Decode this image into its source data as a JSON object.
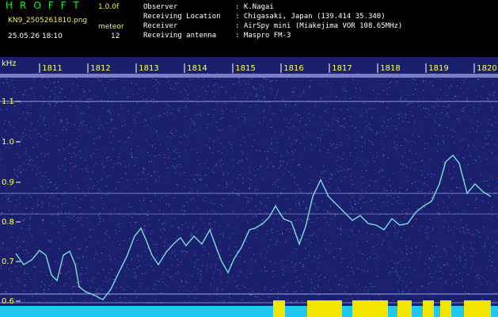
{
  "header": {
    "brand": "HROFFT",
    "version": "1.0.0f",
    "filename": "KN9_2505261810.png",
    "meteor_label": "meteor",
    "timestamp": "25.05.26 18:10",
    "meteor_count": "12",
    "fields": [
      {
        "label": "Observer",
        "value": ": K.Nagai"
      },
      {
        "label": "Receiving Location",
        "value": ": Chigasaki, Japan (139.414 35.340)"
      },
      {
        "label": "Receiver",
        "value": ": AirSpy mini (Miakejima VOR 108.65MHz)"
      },
      {
        "label": "Receiving antenna",
        "value": ": Maspro FM-3"
      }
    ]
  },
  "spectrogram": {
    "y_unit": "kHz",
    "y_ticks": [
      "1.1",
      "1.0",
      "0.9",
      "0.8",
      "0.7",
      "0.6"
    ],
    "x_ticks": [
      "1811",
      "1812",
      "1813",
      "1814",
      "1815",
      "1816",
      "1817",
      "1818",
      "1819",
      "1820"
    ],
    "colors": {
      "background": "#1a1f6e",
      "trace": "#7fe0d8",
      "axis_text": "#ffff55",
      "bottom_bar": "#1ec8f0",
      "activity": "#f2e600"
    }
  }
}
